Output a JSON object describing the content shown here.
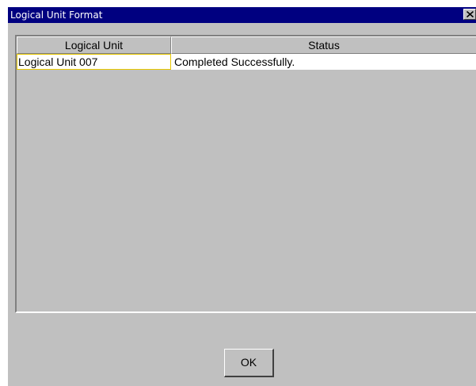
{
  "window": {
    "title": "Logical Unit Format"
  },
  "table": {
    "columns": [
      "Logical Unit",
      "Status"
    ],
    "rows": [
      {
        "logical_unit": "Logical Unit 007",
        "status": "Completed Successfully."
      }
    ]
  },
  "buttons": {
    "ok_label": "OK"
  },
  "icons": {
    "close": "close-icon"
  },
  "colors": {
    "titlebar": "#000080",
    "face": "#c0c0c0",
    "selection_border": "#e8c800"
  }
}
